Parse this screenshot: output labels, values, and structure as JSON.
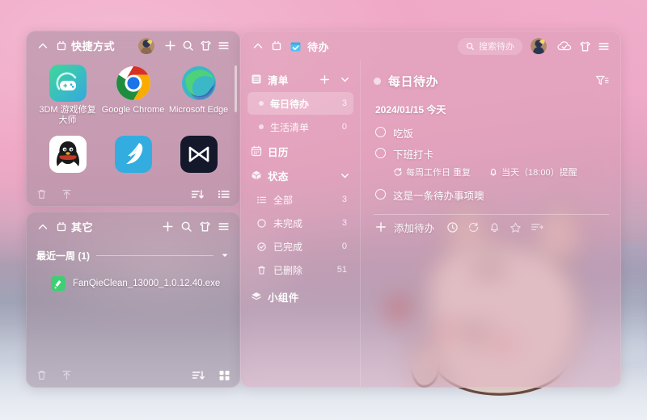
{
  "wallpaper": {
    "description": "pink-sunset-gradient",
    "accent": "#eeaecb"
  },
  "shortcuts_panel": {
    "title": "快捷方式",
    "header_icons": [
      "collapse-chevron-icon",
      "pin-icon",
      "avatar",
      "plus-icon",
      "search-icon",
      "shirt-icon",
      "menu-icon"
    ],
    "apps": [
      {
        "label": "3DM 游戏修复大师",
        "icon": "3dm-game-repair-icon",
        "shortcut": true
      },
      {
        "label": "Google Chrome",
        "icon": "chrome-icon",
        "shortcut": true
      },
      {
        "label": "Microsoft Edge",
        "icon": "edge-icon",
        "shortcut": true
      },
      {
        "label": "",
        "icon": "qq-icon",
        "shortcut": false
      },
      {
        "label": "",
        "icon": "dove-icon",
        "shortcut": false
      },
      {
        "label": "",
        "icon": "capcut-icon",
        "shortcut": false
      }
    ],
    "footer_icons": [
      "trash-icon",
      "upload-icon",
      "sort-icon",
      "list-view-icon"
    ]
  },
  "other_panel": {
    "title": "其它",
    "header_icons": [
      "collapse-chevron-icon",
      "pin-icon",
      "plus-icon",
      "search-icon",
      "shirt-icon",
      "menu-icon"
    ],
    "group_label": "最近一周 (1)",
    "files": [
      {
        "name": "FanQieClean_13000_1.0.12.40.exe",
        "icon": "cleaner-app-icon"
      }
    ],
    "footer_icons": [
      "trash-icon",
      "upload-icon",
      "sort-icon",
      "grid-view-icon"
    ]
  },
  "todo_app": {
    "title": "待办",
    "title_icon": "calendar-check-icon",
    "header_icons": [
      "collapse-chevron-icon",
      "pin-icon",
      "avatar",
      "cloud-sync-icon",
      "shirt-icon",
      "menu-icon"
    ],
    "search": {
      "placeholder": "搜索待办",
      "icon": "search-icon"
    },
    "sidebar": {
      "lists_section": {
        "label": "清单",
        "icon": "list-icon",
        "add_icon": "plus-icon",
        "collapse_icon": "chevron-down-icon"
      },
      "lists": [
        {
          "label": "每日待办",
          "count": "3",
          "active": true
        },
        {
          "label": "生活清单",
          "count": "0",
          "active": false
        }
      ],
      "calendar": {
        "label": "日历",
        "icon": "calendar-icon"
      },
      "status_section": {
        "label": "状态",
        "icon": "cube-icon",
        "collapse_icon": "chevron-down-icon"
      },
      "status_items": [
        {
          "label": "全部",
          "count": "3",
          "icon": "list-bullets-icon"
        },
        {
          "label": "未完成",
          "count": "3",
          "icon": "circle-icon"
        },
        {
          "label": "已完成",
          "count": "0",
          "icon": "check-circle-icon"
        },
        {
          "label": "已删除",
          "count": "51",
          "icon": "trash-icon"
        }
      ],
      "widgets": {
        "label": "小组件",
        "icon": "widget-icon"
      }
    },
    "main": {
      "list_title": "每日待办",
      "filter_icon": "filter-icon",
      "date_group": "2024/01/15  今天",
      "tasks": [
        {
          "text": "吃饭",
          "done": false,
          "meta": []
        },
        {
          "text": "下班打卡",
          "done": false,
          "meta": [
            {
              "icon": "repeat-icon",
              "text": "每周工作日  重复"
            },
            {
              "icon": "bell-icon",
              "text": "当天（18:00）提醒"
            }
          ]
        },
        {
          "text": "这是一条待办事项噢",
          "done": false,
          "meta": []
        }
      ],
      "add_row": {
        "label": "添加待办",
        "plus_icon": "plus-icon",
        "icons": [
          "clock-icon",
          "repeat-icon",
          "bell-icon",
          "star-icon",
          "list-flag-icon"
        ]
      }
    }
  }
}
